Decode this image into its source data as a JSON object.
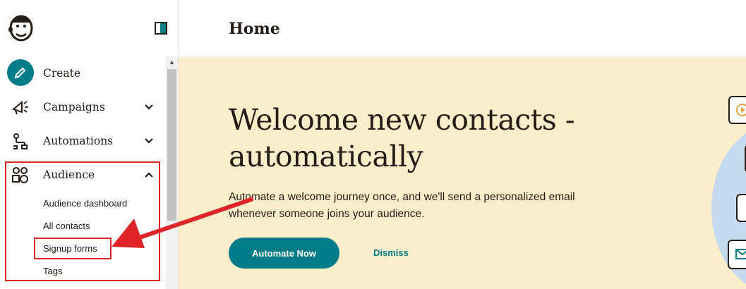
{
  "header": {
    "title": "Home"
  },
  "sidebar": {
    "items": [
      {
        "label": "Create",
        "icon": "pencil-icon"
      },
      {
        "label": "Campaigns",
        "icon": "megaphone-icon"
      },
      {
        "label": "Automations",
        "icon": "workflow-icon"
      },
      {
        "label": "Audience",
        "icon": "audience-icon"
      }
    ],
    "audience_sub": [
      "Audience dashboard",
      "All contacts",
      "Signup forms",
      "Tags"
    ]
  },
  "hero": {
    "title": "Welcome new contacts - automatically",
    "description": "Automate a welcome journey once, and we'll send a personalized email whenever someone joins your audience.",
    "primary_label": "Automate Now",
    "dismiss_label": "Dismiss"
  },
  "colors": {
    "accent": "#007c89",
    "banner": "#fbeecb",
    "highlight": "#e0252a",
    "text": "#241c15"
  }
}
